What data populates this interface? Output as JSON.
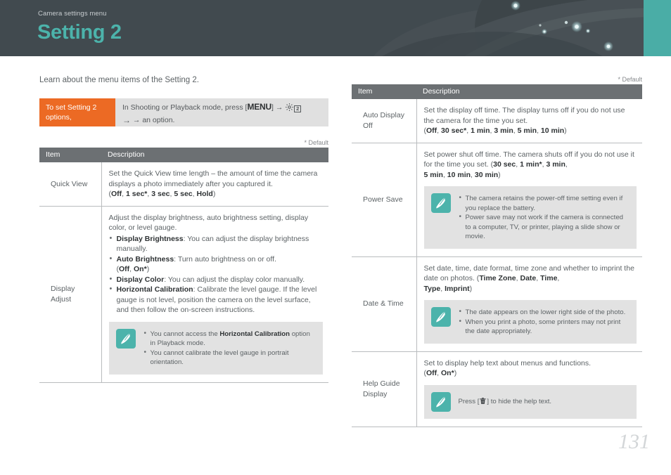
{
  "header": {
    "kicker": "Camera settings menu",
    "title": "Setting 2",
    "accent_teal": "#4cb3ab",
    "bg": "#414a4f"
  },
  "intro": {
    "line": "Learn about the menu items of the Setting 2."
  },
  "howto": {
    "label": "To set Setting 2 options,",
    "body_before": "In Shooting or Playback mode, press [",
    "menu_key": "MENU",
    "body_mid": "] → ",
    "gear_icon": "gear-icon",
    "badge": "2",
    "body_after": "→ an option.",
    "accent_orange": "#ec6a24"
  },
  "default_note": "* Default",
  "left_table": {
    "columns": [
      "Item",
      "Description"
    ],
    "rows": [
      {
        "item": "Quick View",
        "desc_paragraphs": [
          "Set the Quick View time length – the amount of time the camera displays a photo immediately after you captured it."
        ],
        "options_line": {
          "open": "(",
          "values": [
            "Off",
            "1 sec*",
            "3 sec",
            "5 sec",
            "Hold"
          ],
          "close": ")"
        }
      },
      {
        "item": "Display Adjust",
        "desc_paragraphs": [
          "Adjust the display brightness, auto brightness setting, display color, or level gauge."
        ],
        "bullets": [
          {
            "term": "Display Brightness",
            "text": ": You can adjust the display brightness manually."
          },
          {
            "term": "Auto Brightness",
            "text": ": Turn auto brightness on or off.",
            "options": "(Off, On*)"
          },
          {
            "term": "Display Color",
            "text": ": You can adjust the display color manually."
          },
          {
            "term": "Horizontal Calibration",
            "text": ": Calibrate the level gauge. If the level gauge is not level, position the camera on the level surface, and then follow the on-screen instructions."
          }
        ],
        "tip": {
          "icon": "note-pen-icon",
          "bullets": [
            {
              "pre": "You cannot access the ",
              "bold": "Horizontal Calibration",
              "post": " option in Playback mode."
            },
            {
              "pre": "You cannot calibrate the level gauge in portrait orientation.",
              "bold": "",
              "post": ""
            }
          ]
        }
      }
    ]
  },
  "right_table": {
    "columns": [
      "Item",
      "Description"
    ],
    "rows": [
      {
        "item": "Auto Display Off",
        "desc_paragraphs": [
          "Set the display off time. The display turns off if you do not use the camera for the time you set."
        ],
        "options_line": {
          "open": "(",
          "values": [
            "Off",
            "30 sec*",
            "1 min",
            "3 min",
            "5 min",
            "10 min"
          ],
          "close": ")"
        }
      },
      {
        "item": "Power Save",
        "desc_inline": {
          "lead": "Set power shut off time. The camera shuts off if you do not use it for the time you set. (",
          "values": [
            "30 sec",
            "1 min*",
            "3 min",
            "5 min",
            "10 min",
            "30 min"
          ],
          "close": ")"
        },
        "tip": {
          "icon": "note-pen-icon",
          "bullets": [
            {
              "pre": "The camera retains the power-off time setting even if you replace the battery.",
              "bold": "",
              "post": ""
            },
            {
              "pre": "Power save may not work if the camera is connected to a computer, TV, or printer, playing a slide show or movie.",
              "bold": "",
              "post": ""
            }
          ]
        }
      },
      {
        "item": "Date & Time",
        "desc_inline": {
          "lead": "Set date, time, date format, time zone and whether to imprint the date on photos. (",
          "values": [
            "Time Zone",
            "Date",
            "Time",
            "Type",
            "Imprint"
          ],
          "close": ")"
        },
        "tip": {
          "icon": "note-pen-icon",
          "bullets": [
            {
              "pre": "The date appears on the lower right side of the photo.",
              "bold": "",
              "post": ""
            },
            {
              "pre": "When you print a photo, some printers may not print the date appropriately.",
              "bold": "",
              "post": ""
            }
          ]
        }
      },
      {
        "item": "Help Guide Display",
        "desc_paragraphs": [
          "Set to display help text about menus and functions."
        ],
        "options_line": {
          "open": "(",
          "values": [
            "Off",
            "On*"
          ],
          "close": ")"
        },
        "tip_single": {
          "icon": "note-pen-icon",
          "pre": "Press [",
          "key_icon": "trash-icon",
          "post": "] to hide the help text."
        }
      }
    ]
  },
  "footer": {
    "page_number": "131"
  }
}
